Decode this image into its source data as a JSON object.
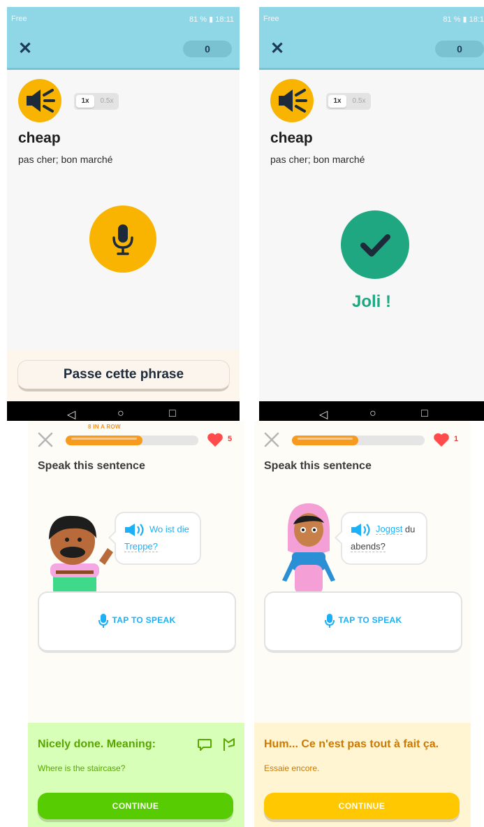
{
  "top_left": {
    "status": {
      "carrier": "Free",
      "right_text": "81 %",
      "time": "18:11"
    },
    "score": "0",
    "speed": {
      "fast": "1x",
      "slow": "0.5x"
    },
    "word": "cheap",
    "translation": "pas cher; bon marché",
    "skip_button": "Passe cette phrase"
  },
  "top_right": {
    "status": {
      "carrier": "Free",
      "right_text": "81 %",
      "time": "18:1"
    },
    "score": "0",
    "speed": {
      "fast": "1x",
      "slow": "0.5x"
    },
    "word": "cheap",
    "translation": "pas cher; bon marché",
    "result": "Joli !"
  },
  "bottom_left": {
    "streak_label": "8 IN A ROW",
    "progress": 0.58,
    "hearts": "5",
    "prompt": "Speak this sentence",
    "bubble": {
      "line1_words": "Wo ist die",
      "line2_words": "Treppe?"
    },
    "tap_to_speak": "TAP TO SPEAK",
    "feedback": {
      "title": "Nicely done. Meaning:",
      "subtitle": "Where is the staircase?",
      "button": "CONTINUE",
      "bg": "#d7ffb8",
      "title_color": "#58a700",
      "button_color": "#58cc02"
    }
  },
  "bottom_right": {
    "progress": 0.5,
    "hearts": "1",
    "prompt": "Speak this sentence",
    "bubble": {
      "line1_blue": "Joggst",
      "line1_plain": " du",
      "line2_words": "abends?"
    },
    "tap_to_speak": "TAP TO SPEAK",
    "feedback": {
      "title": "Hum... Ce n'est pas tout à fait ça.",
      "subtitle": "Essaie encore.",
      "button": "CONTINUE",
      "bg": "#fff5d3",
      "title_color": "#cd7900",
      "button_color": "#ffc800"
    }
  }
}
